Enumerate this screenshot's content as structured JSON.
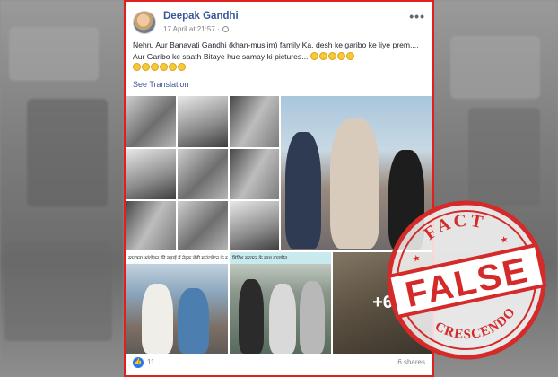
{
  "post": {
    "author": "Deepak Gandhi",
    "timestamp": "17 April at 21:57 ·",
    "more_label": "•••",
    "text": "Nehru Aur Banavati Gandhi (khan-muslim) family Ka, desh ke garibo ke liye prem.... Aur Garibo ke saath Bitaye hue samay ki pictures...",
    "see_translation": "See Translation"
  },
  "photos": {
    "caption_1": "स्वतंत्रता आंदोलन की लड़ाई में नेहरू लेडी माउंटबेटन के साथ",
    "caption_2": "ब्रिटिश सरकार के साथ बातचीत",
    "more_count": "+6"
  },
  "footer": {
    "likes": "11",
    "shares": "6 shares"
  },
  "stamp": {
    "top_text": "FACT",
    "main_text": "FALSE",
    "bottom_text": "CRESCENDO",
    "color": "#d42a2a"
  }
}
